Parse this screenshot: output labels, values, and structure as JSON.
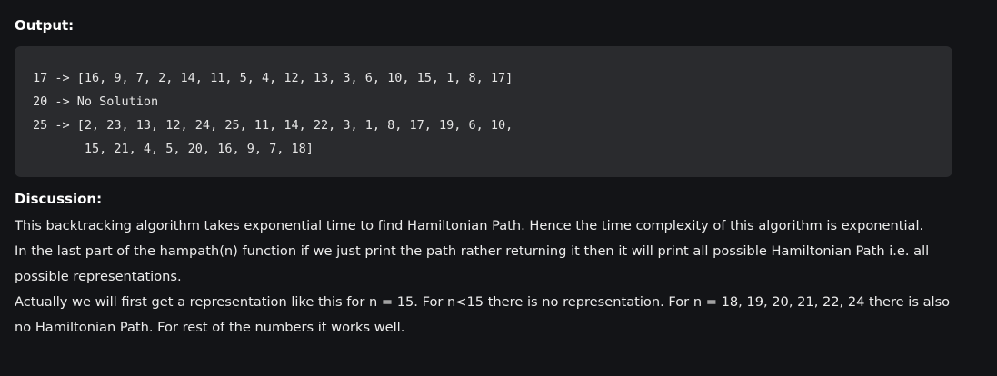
{
  "output": {
    "heading": "Output:",
    "lines": [
      "17 -> [16, 9, 7, 2, 14, 11, 5, 4, 12, 13, 3, 6, 10, 15, 1, 8, 17]",
      "20 -> No Solution",
      "25 -> [2, 23, 13, 12, 24, 25, 11, 14, 22, 3, 1, 8, 17, 19, 6, 10,",
      "       15, 21, 4, 5, 20, 16, 9, 7, 18]"
    ]
  },
  "discussion": {
    "heading": "Discussion:",
    "paragraphs": [
      "This backtracking algorithm takes exponential time to find Hamiltonian Path. Hence the time complexity of this algorithm is exponential.",
      "In the last part of the hampath(n) function if we just print the path rather returning it then it will print all possible Hamiltonian Path i.e. all possible representations.",
      "Actually we will first get a representation like this for n = 15. For n<15 there is no representation. For n = 18, 19, 20, 21, 22, 24 there is also no Hamiltonian Path. For rest of the numbers it works well."
    ]
  }
}
